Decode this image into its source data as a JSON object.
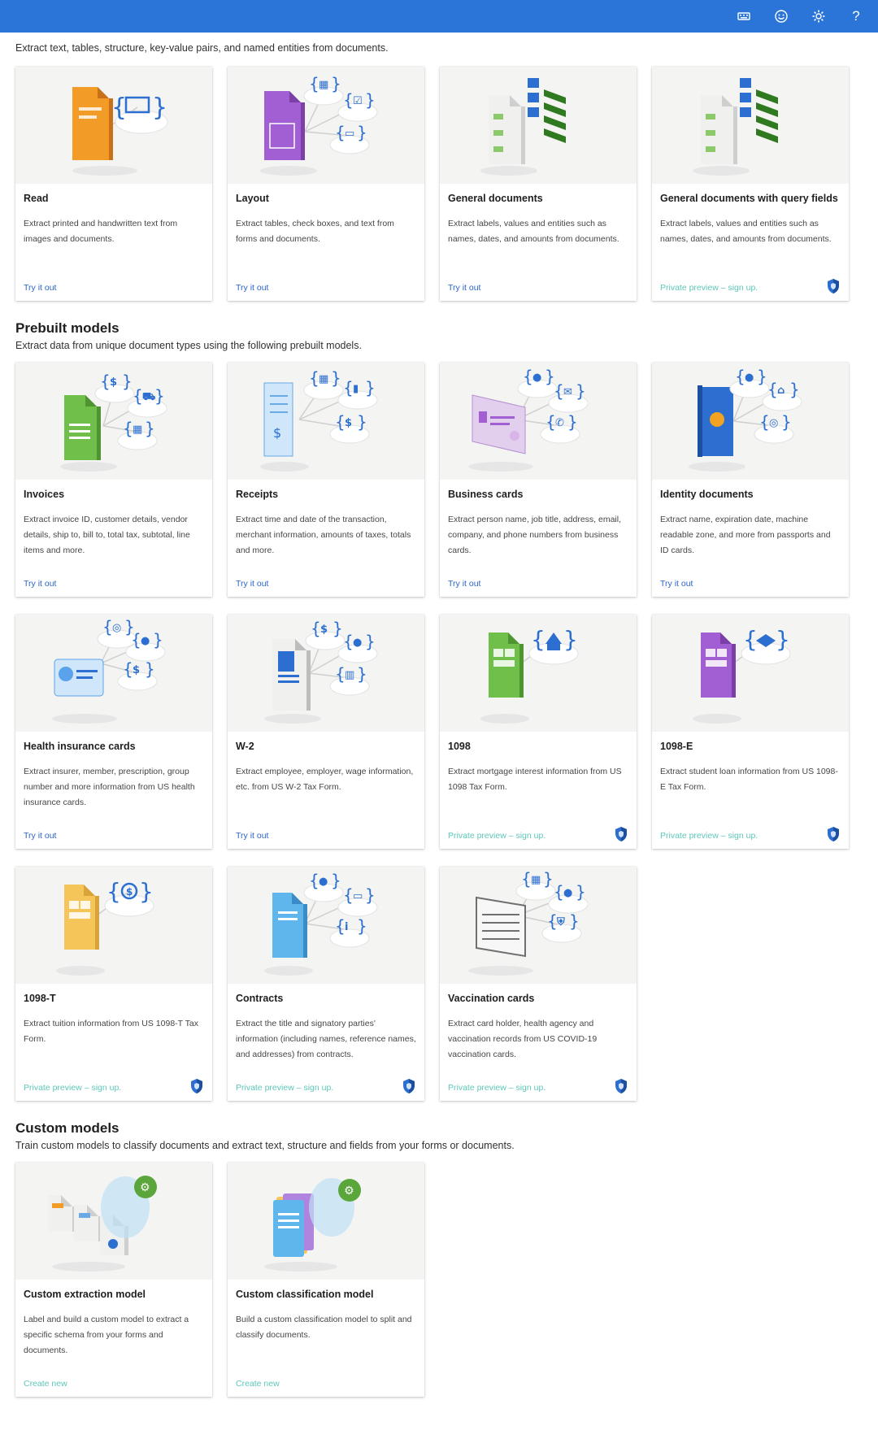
{
  "topbar": {
    "icons": [
      "keyboard-icon",
      "feedback-smiley-icon",
      "settings-gear-icon",
      "help-question-icon"
    ],
    "help_label": "?"
  },
  "analysis": {
    "description": "Extract text, tables, structure, key-value pairs, and named entities from documents.",
    "cards": [
      {
        "title": "Read",
        "desc": "Extract printed and handwritten text from images and documents.",
        "action": "Try it out",
        "preview": false,
        "art": "orange-doc"
      },
      {
        "title": "Layout",
        "desc": "Extract tables, check boxes, and text from forms and documents.",
        "action": "Try it out",
        "preview": false,
        "art": "purple-doc"
      },
      {
        "title": "General documents",
        "desc": "Extract labels, values and entities such as names, dates, and amounts from documents.",
        "action": "Try it out",
        "preview": false,
        "art": "kv-doc"
      },
      {
        "title": "General documents with query fields",
        "desc": "Extract labels, values and entities such as names, dates, and amounts from documents.",
        "action": "Private preview – sign up.",
        "preview": true,
        "art": "kv-doc"
      }
    ]
  },
  "prebuilt": {
    "title": "Prebuilt models",
    "description": "Extract data from unique document types using the following prebuilt models.",
    "cards": [
      {
        "title": "Invoices",
        "desc": "Extract invoice ID, customer details, vendor details, ship to, bill to, total tax, subtotal, line items and more.",
        "action": "Try it out",
        "preview": false,
        "art": "green-doc"
      },
      {
        "title": "Receipts",
        "desc": "Extract time and date of the transaction, merchant information, amounts of taxes, totals and more.",
        "action": "Try it out",
        "preview": false,
        "art": "receipt"
      },
      {
        "title": "Business cards",
        "desc": "Extract person name, job title, address, email, company, and phone numbers from business cards.",
        "action": "Try it out",
        "preview": false,
        "art": "bizcard"
      },
      {
        "title": "Identity documents",
        "desc": "Extract name, expiration date, machine readable zone, and more from passports and ID cards.",
        "action": "Try it out",
        "preview": false,
        "art": "passport"
      },
      {
        "title": "Health insurance cards",
        "desc": "Extract insurer, member, prescription, group number and more information from US health insurance cards.",
        "action": "Try it out",
        "preview": false,
        "art": "health"
      },
      {
        "title": "W-2",
        "desc": "Extract employee, employer, wage information, etc. from US W-2 Tax Form.",
        "action": "Try it out",
        "preview": false,
        "art": "w2"
      },
      {
        "title": "1098",
        "desc": "Extract mortgage interest information from US 1098 Tax Form.",
        "action": "Private preview – sign up.",
        "preview": true,
        "art": "1098"
      },
      {
        "title": "1098-E",
        "desc": "Extract student loan information from US 1098-E Tax Form.",
        "action": "Private preview – sign up.",
        "preview": true,
        "art": "1098e"
      },
      {
        "title": "1098-T",
        "desc": "Extract tuition information from US 1098-T Tax Form.",
        "action": "Private preview – sign up.",
        "preview": true,
        "art": "1098t"
      },
      {
        "title": "Contracts",
        "desc": "Extract the title and signatory parties' information (including names, reference names, and addresses) from contracts.",
        "action": "Private preview – sign up.",
        "preview": true,
        "art": "contract"
      },
      {
        "title": "Vaccination cards",
        "desc": "Extract card holder, health agency and vaccination records from US COVID-19 vaccination cards.",
        "action": "Private preview – sign up.",
        "preview": true,
        "art": "vaccine"
      }
    ]
  },
  "custom": {
    "title": "Custom models",
    "description": "Train custom models to classify documents and extract text, structure and fields from your forms or documents.",
    "cards": [
      {
        "title": "Custom extraction model",
        "desc": "Label and build a custom model to extract a specific schema from your forms and documents.",
        "action": "Create new",
        "preview": true,
        "art": "custom-extract"
      },
      {
        "title": "Custom classification model",
        "desc": "Build a custom classification model to split and classify documents.",
        "action": "Create new",
        "preview": true,
        "art": "custom-classify"
      }
    ]
  },
  "colors": {
    "topbar": "#2b74d8",
    "link": "#2b64c9",
    "preview_link": "#5ec7b9"
  }
}
